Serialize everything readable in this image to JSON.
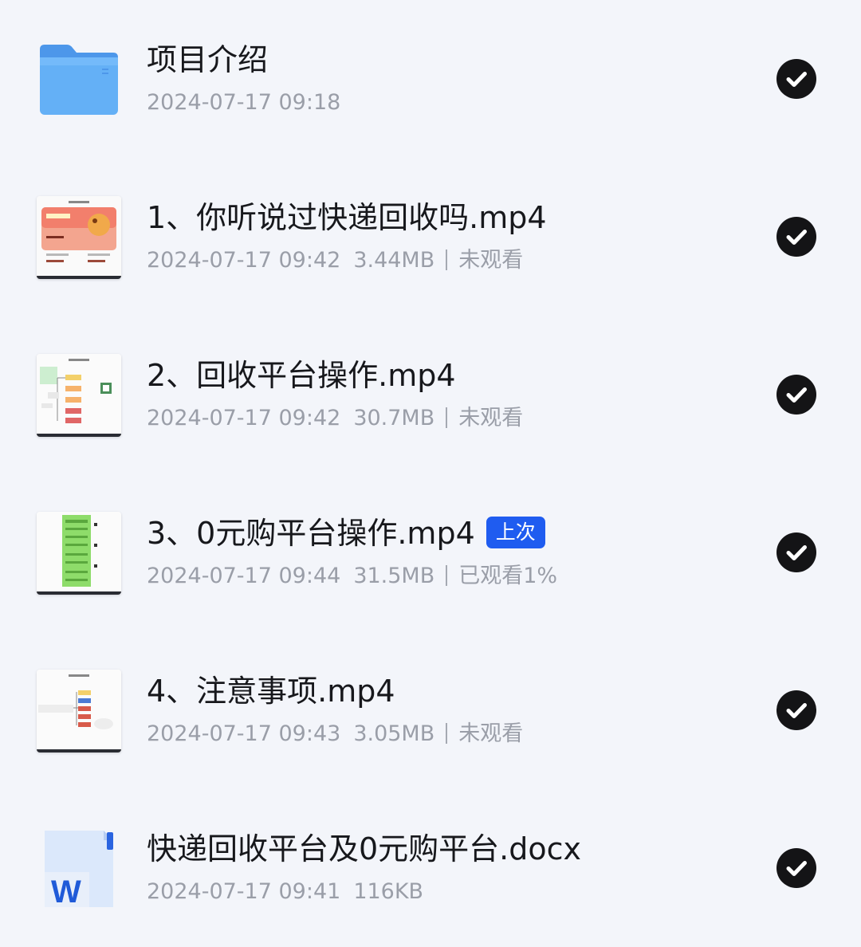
{
  "files": [
    {
      "title": "项目介绍",
      "date": "2024-07-17 09:18",
      "icon": "folder-icon"
    },
    {
      "title": "1、你听说过快递回收吗.mp4",
      "date": "2024-07-17 09:42",
      "size": "3.44MB",
      "status": "未观看",
      "icon": "video-thumbnail"
    },
    {
      "title": "2、回收平台操作.mp4",
      "date": "2024-07-17 09:42",
      "size": "30.7MB",
      "status": "未观看",
      "icon": "video-thumbnail"
    },
    {
      "title": "3、0元购平台操作.mp4",
      "badge": "上次",
      "date": "2024-07-17 09:44",
      "size": "31.5MB",
      "status": "已观看1%",
      "icon": "video-thumbnail"
    },
    {
      "title": "4、注意事项.mp4",
      "date": "2024-07-17 09:43",
      "size": "3.05MB",
      "status": "未观看",
      "icon": "video-thumbnail"
    },
    {
      "title": "快递回收平台及0元购平台.docx",
      "date": "2024-07-17 09:41",
      "size": "116KB",
      "icon": "word-doc-icon",
      "icon_letter": "W"
    }
  ],
  "colors": {
    "background": "#f3f5fa",
    "badge": "#1f5cf0",
    "folder": "#5aa8f5",
    "check": "#141416",
    "meta_text": "#9a9ea8"
  }
}
